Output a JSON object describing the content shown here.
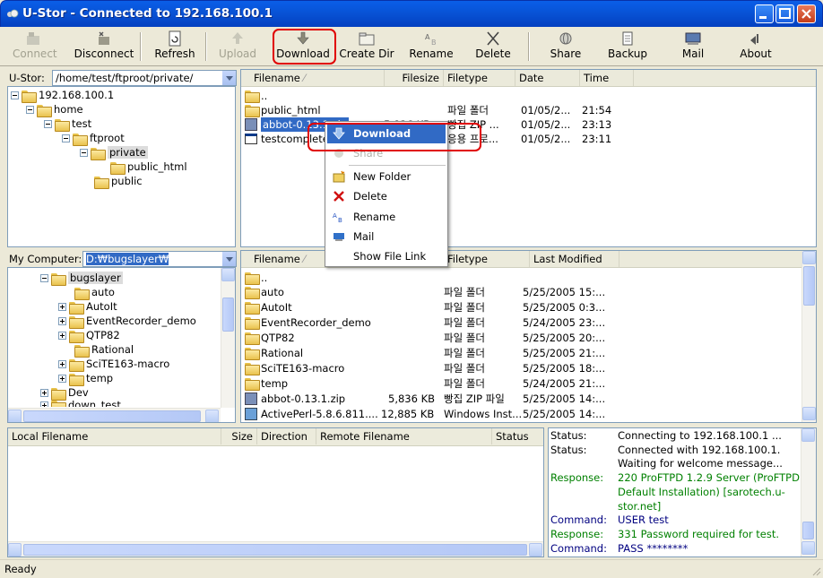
{
  "window": {
    "title": "U-Stor - Connected to 192.168.100.1"
  },
  "toolbar": {
    "connect": "Connect",
    "disconnect": "Disconnect",
    "refresh": "Refresh",
    "upload": "Upload",
    "download": "Download",
    "create_dir": "Create Dir",
    "rename": "Rename",
    "delete": "Delete",
    "share": "Share",
    "backup": "Backup",
    "mail": "Mail",
    "about": "About"
  },
  "remote": {
    "label": "U-Stor:",
    "path": "/home/test/ftproot/private/",
    "tree": [
      "192.168.100.1",
      "home",
      "test",
      "ftproot",
      "private",
      "public_html",
      "public"
    ],
    "columns": {
      "filename": "Filename",
      "filesize": "Filesize",
      "filetype": "Filetype",
      "date": "Date",
      "time": "Time"
    },
    "files": [
      {
        "name": "..",
        "size": "",
        "type": "",
        "date": "",
        "time": ""
      },
      {
        "name": "public_html",
        "size": "",
        "type": "파일 폴더",
        "date": "01/05/2...",
        "time": "21:54"
      },
      {
        "name": "abbot-0.13.1.zip",
        "size": "5,836 KB",
        "type": "빵집 ZIP ...",
        "date": "01/05/2...",
        "time": "23:13"
      },
      {
        "name": "testcomplete",
        "size": "",
        "type": "응용 프로...",
        "date": "01/05/2...",
        "time": "23:11"
      }
    ]
  },
  "context_menu": {
    "download": "Download",
    "share": "Share",
    "new_folder": "New Folder",
    "delete": "Delete",
    "rename": "Rename",
    "mail": "Mail",
    "show_link": "Show File Link"
  },
  "local": {
    "label": "My Computer:",
    "path": "D:₩bugslayer₩",
    "tree": [
      "bugslayer",
      "auto",
      "AutoIt",
      "EventRecorder_demo",
      "QTP82",
      "Rational",
      "SciTE163-macro",
      "temp",
      "Dev",
      "down_test"
    ],
    "columns": {
      "filename": "Filename",
      "filetype": "Filetype",
      "modified": "Last Modified"
    },
    "files": [
      {
        "name": "..",
        "size": "",
        "type": "",
        "modified": ""
      },
      {
        "name": "auto",
        "size": "",
        "type": "파일 폴더",
        "modified": "5/25/2005 15:..."
      },
      {
        "name": "AutoIt",
        "size": "",
        "type": "파일 폴더",
        "modified": "5/25/2005 0:3..."
      },
      {
        "name": "EventRecorder_demo",
        "size": "",
        "type": "파일 폴더",
        "modified": "5/24/2005 23:..."
      },
      {
        "name": "QTP82",
        "size": "",
        "type": "파일 폴더",
        "modified": "5/25/2005 20:..."
      },
      {
        "name": "Rational",
        "size": "",
        "type": "파일 폴더",
        "modified": "5/25/2005 21:..."
      },
      {
        "name": "SciTE163-macro",
        "size": "",
        "type": "파일 폴더",
        "modified": "5/25/2005 18:..."
      },
      {
        "name": "temp",
        "size": "",
        "type": "파일 폴더",
        "modified": "5/24/2005 21:..."
      },
      {
        "name": "abbot-0.13.1.zip",
        "size": "5,836 KB",
        "type": "빵집 ZIP 파일",
        "modified": "5/25/2005 14:..."
      },
      {
        "name": "ActivePerl-5.8.6.811....",
        "size": "12,885 KB",
        "type": "Windows Inst...",
        "modified": "5/25/2005 14:..."
      }
    ]
  },
  "queue": {
    "columns": {
      "local": "Local Filename",
      "size": "Size",
      "direction": "Direction",
      "remote": "Remote Filename",
      "status": "Status"
    }
  },
  "log": [
    {
      "key": "Status:",
      "text": "Connecting to 192.168.100.1 ...",
      "kind": "status"
    },
    {
      "key": "Status:",
      "text": "Connected with 192.168.100.1.",
      "kind": "status"
    },
    {
      "key": "",
      "text": "Waiting for welcome message...",
      "kind": "status"
    },
    {
      "key": "Response:",
      "text": "220 ProFTPD 1.2.9 Server (ProFTPD",
      "kind": "response"
    },
    {
      "key": "",
      "text": "Default Installation) [sarotech.u-",
      "kind": "response"
    },
    {
      "key": "",
      "text": "stor.net]",
      "kind": "response"
    },
    {
      "key": "Command:",
      "text": "USER test",
      "kind": "command"
    },
    {
      "key": "Response:",
      "text": "331 Password required for test.",
      "kind": "response"
    },
    {
      "key": "Command:",
      "text": "PASS ********",
      "kind": "command"
    }
  ],
  "statusbar": {
    "text": "Ready"
  },
  "colors": {
    "titlebar": "#0853d6",
    "selection": "#316ac5",
    "response": "#008000",
    "command": "#000080",
    "highlight": "#e00000"
  }
}
